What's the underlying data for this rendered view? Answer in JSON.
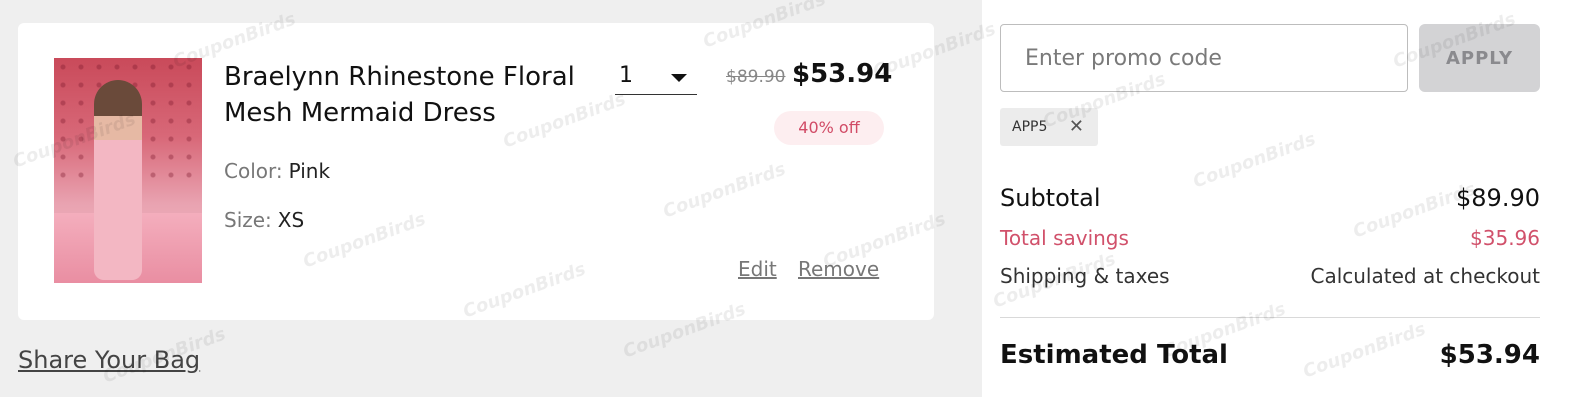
{
  "cart_item": {
    "title": "Braelynn Rhinestone Floral Mesh Mermaid Dress",
    "color_label": "Color:",
    "color_value": "Pink",
    "size_label": "Size:",
    "size_value": "XS",
    "quantity": "1",
    "original_price": "$89.90",
    "sale_price": "$53.94",
    "discount_badge": "40% off",
    "edit_label": "Edit",
    "remove_label": "Remove"
  },
  "share_label": "Share Your Bag",
  "promo": {
    "placeholder": "Enter promo code",
    "apply_label": "APPLY",
    "applied_code": "APP5",
    "remove_icon": "close-icon"
  },
  "summary": {
    "subtotal_label": "Subtotal",
    "subtotal_value": "$89.90",
    "savings_label": "Total savings",
    "savings_value": "$35.96",
    "shipping_label": "Shipping & taxes",
    "shipping_value": "Calculated at checkout",
    "total_label": "Estimated Total",
    "total_value": "$53.94"
  },
  "watermark": "CouponBirds",
  "colors": {
    "accent_pink": "#d1516b",
    "badge_bg": "#fdeef0",
    "apply_disabled": "#d3d3d5"
  }
}
